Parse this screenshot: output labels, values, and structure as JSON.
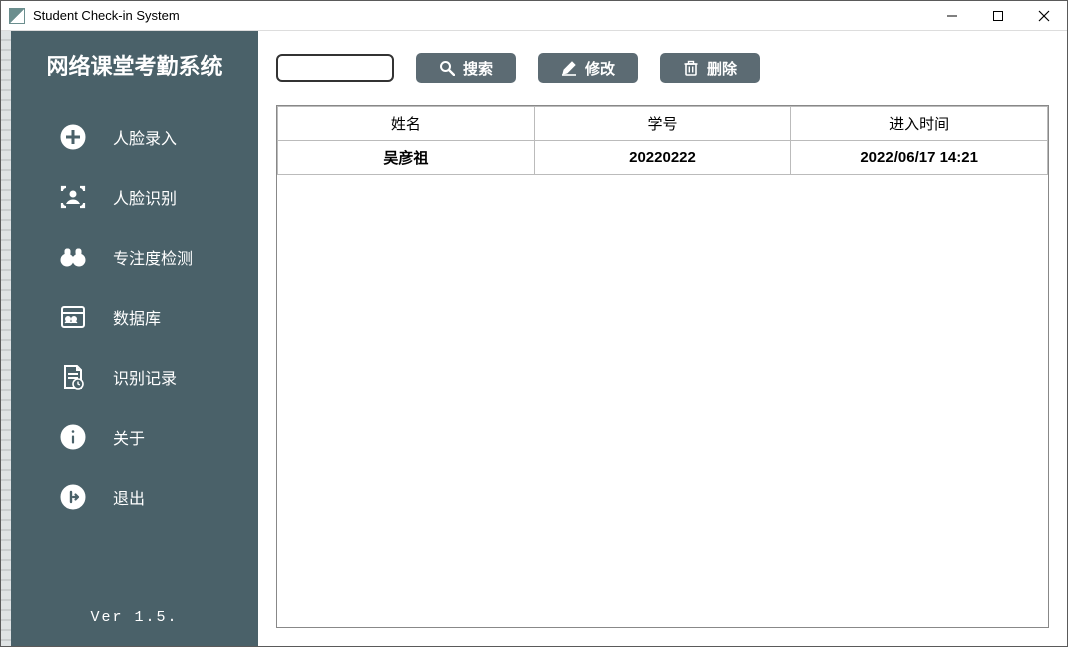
{
  "window": {
    "title": "Student Check-in System"
  },
  "sidebar": {
    "title": "网络课堂考勤系统",
    "items": [
      {
        "label": "人脸录入"
      },
      {
        "label": "人脸识别"
      },
      {
        "label": "专注度检测"
      },
      {
        "label": "数据库"
      },
      {
        "label": "识别记录"
      },
      {
        "label": "关于"
      },
      {
        "label": "退出"
      }
    ],
    "version": "Ver 1.5."
  },
  "toolbar": {
    "search_value": "",
    "search_label": "搜索",
    "edit_label": "修改",
    "delete_label": "删除"
  },
  "table": {
    "columns": [
      "姓名",
      "学号",
      "进入时间"
    ],
    "rows": [
      {
        "name": "吴彦祖",
        "id": "20220222",
        "time": "2022/06/17 14:21"
      }
    ]
  }
}
